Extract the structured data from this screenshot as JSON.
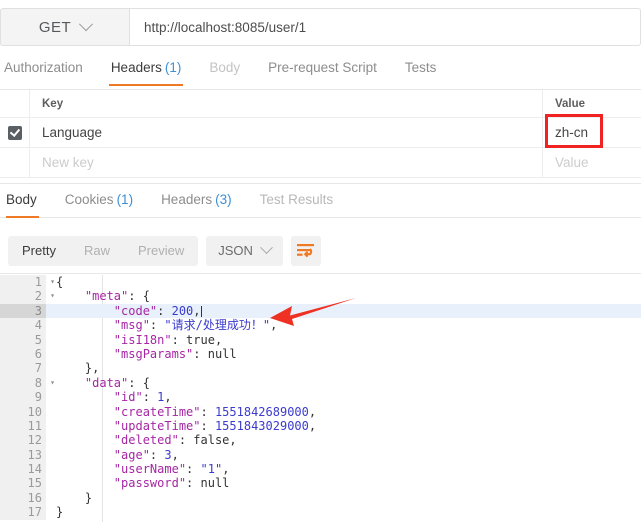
{
  "request": {
    "method": "GET",
    "method_chevron_icon": "chevron-down-icon",
    "url": "http://localhost:8085/user/1",
    "tabs": [
      {
        "label": "Authorization",
        "count": "",
        "state": "normal"
      },
      {
        "label": "Headers",
        "count": "(1)",
        "state": "active"
      },
      {
        "label": "Body",
        "count": "",
        "state": "dim"
      },
      {
        "label": "Pre-request Script",
        "count": "",
        "state": "normal"
      },
      {
        "label": "Tests",
        "count": "",
        "state": "normal"
      }
    ]
  },
  "headers_table": {
    "col_key": "Key",
    "col_value": "Value",
    "rows": [
      {
        "checked": true,
        "key": "Language",
        "value": "zh-cn",
        "highlighted": true
      }
    ],
    "new_row": {
      "key_placeholder": "New key",
      "value_placeholder": "Value"
    }
  },
  "response": {
    "tabs": [
      {
        "label": "Body",
        "count": "",
        "state": "active"
      },
      {
        "label": "Cookies",
        "count": "(1)",
        "state": "normal"
      },
      {
        "label": "Headers",
        "count": "(3)",
        "state": "normal"
      },
      {
        "label": "Test Results",
        "count": "",
        "state": "dim"
      }
    ],
    "view_modes": [
      {
        "label": "Pretty",
        "active": true
      },
      {
        "label": "Raw",
        "active": false
      },
      {
        "label": "Preview",
        "active": false
      }
    ],
    "format": "JSON",
    "format_chevron_icon": "chevron-down-icon",
    "wrap_button_icon": "word-wrap-icon"
  },
  "code": {
    "lines": [
      {
        "n": "1",
        "fold": "▾",
        "active": false,
        "tokens": [
          {
            "t": "p",
            "v": "{"
          }
        ]
      },
      {
        "n": "2",
        "fold": "▾",
        "active": false,
        "tokens": [
          {
            "t": "p",
            "v": "    "
          },
          {
            "t": "k",
            "v": "\"meta\""
          },
          {
            "t": "p",
            "v": ": {"
          }
        ]
      },
      {
        "n": "3",
        "fold": "",
        "active": true,
        "tokens": [
          {
            "t": "p",
            "v": "        "
          },
          {
            "t": "k",
            "v": "\"code\""
          },
          {
            "t": "p",
            "v": ": "
          },
          {
            "t": "num",
            "v": "200"
          },
          {
            "t": "p",
            "v": ","
          },
          {
            "t": "caret",
            "v": ""
          }
        ]
      },
      {
        "n": "4",
        "fold": "",
        "active": false,
        "tokens": [
          {
            "t": "p",
            "v": "        "
          },
          {
            "t": "k",
            "v": "\"msg\""
          },
          {
            "t": "p",
            "v": ": "
          },
          {
            "t": "str",
            "v": "\"请求/处理成功！\""
          },
          {
            "t": "p",
            "v": ","
          }
        ]
      },
      {
        "n": "5",
        "fold": "",
        "active": false,
        "tokens": [
          {
            "t": "p",
            "v": "        "
          },
          {
            "t": "k",
            "v": "\"isI18n\""
          },
          {
            "t": "p",
            "v": ": "
          },
          {
            "t": "lit",
            "v": "true"
          },
          {
            "t": "p",
            "v": ","
          }
        ]
      },
      {
        "n": "6",
        "fold": "",
        "active": false,
        "tokens": [
          {
            "t": "p",
            "v": "        "
          },
          {
            "t": "k",
            "v": "\"msgParams\""
          },
          {
            "t": "p",
            "v": ": "
          },
          {
            "t": "lit",
            "v": "null"
          }
        ]
      },
      {
        "n": "7",
        "fold": "",
        "active": false,
        "tokens": [
          {
            "t": "p",
            "v": "    },"
          }
        ]
      },
      {
        "n": "8",
        "fold": "▾",
        "active": false,
        "tokens": [
          {
            "t": "p",
            "v": "    "
          },
          {
            "t": "k",
            "v": "\"data\""
          },
          {
            "t": "p",
            "v": ": {"
          }
        ]
      },
      {
        "n": "9",
        "fold": "",
        "active": false,
        "tokens": [
          {
            "t": "p",
            "v": "        "
          },
          {
            "t": "k",
            "v": "\"id\""
          },
          {
            "t": "p",
            "v": ": "
          },
          {
            "t": "num",
            "v": "1"
          },
          {
            "t": "p",
            "v": ","
          }
        ]
      },
      {
        "n": "10",
        "fold": "",
        "active": false,
        "tokens": [
          {
            "t": "p",
            "v": "        "
          },
          {
            "t": "k",
            "v": "\"createTime\""
          },
          {
            "t": "p",
            "v": ": "
          },
          {
            "t": "num",
            "v": "1551842689000"
          },
          {
            "t": "p",
            "v": ","
          }
        ]
      },
      {
        "n": "11",
        "fold": "",
        "active": false,
        "tokens": [
          {
            "t": "p",
            "v": "        "
          },
          {
            "t": "k",
            "v": "\"updateTime\""
          },
          {
            "t": "p",
            "v": ": "
          },
          {
            "t": "num",
            "v": "1551843029000"
          },
          {
            "t": "p",
            "v": ","
          }
        ]
      },
      {
        "n": "12",
        "fold": "",
        "active": false,
        "tokens": [
          {
            "t": "p",
            "v": "        "
          },
          {
            "t": "k",
            "v": "\"deleted\""
          },
          {
            "t": "p",
            "v": ": "
          },
          {
            "t": "lit",
            "v": "false"
          },
          {
            "t": "p",
            "v": ","
          }
        ]
      },
      {
        "n": "13",
        "fold": "",
        "active": false,
        "tokens": [
          {
            "t": "p",
            "v": "        "
          },
          {
            "t": "k",
            "v": "\"age\""
          },
          {
            "t": "p",
            "v": ": "
          },
          {
            "t": "num",
            "v": "3"
          },
          {
            "t": "p",
            "v": ","
          }
        ]
      },
      {
        "n": "14",
        "fold": "",
        "active": false,
        "tokens": [
          {
            "t": "p",
            "v": "        "
          },
          {
            "t": "k",
            "v": "\"userName\""
          },
          {
            "t": "p",
            "v": ": "
          },
          {
            "t": "str",
            "v": "\"1\""
          },
          {
            "t": "p",
            "v": ","
          }
        ]
      },
      {
        "n": "15",
        "fold": "",
        "active": false,
        "tokens": [
          {
            "t": "p",
            "v": "        "
          },
          {
            "t": "k",
            "v": "\"password\""
          },
          {
            "t": "p",
            "v": ": "
          },
          {
            "t": "lit",
            "v": "null"
          }
        ]
      },
      {
        "n": "16",
        "fold": "",
        "active": false,
        "tokens": [
          {
            "t": "p",
            "v": "    }"
          }
        ]
      },
      {
        "n": "17",
        "fold": "",
        "active": false,
        "tokens": [
          {
            "t": "p",
            "v": "}"
          }
        ]
      }
    ]
  },
  "annotations": {
    "arrow_icon": "red-arrow-left-icon",
    "highlight_box_icon": "red-highlight-box"
  },
  "colors": {
    "accent_orange": "#ef7a25",
    "annotation_red": "#f02222",
    "link_blue": "#3e8fd4",
    "json_key": "#a626a4",
    "json_value": "#3b3bcf",
    "active_line": "#e8f1fb"
  }
}
